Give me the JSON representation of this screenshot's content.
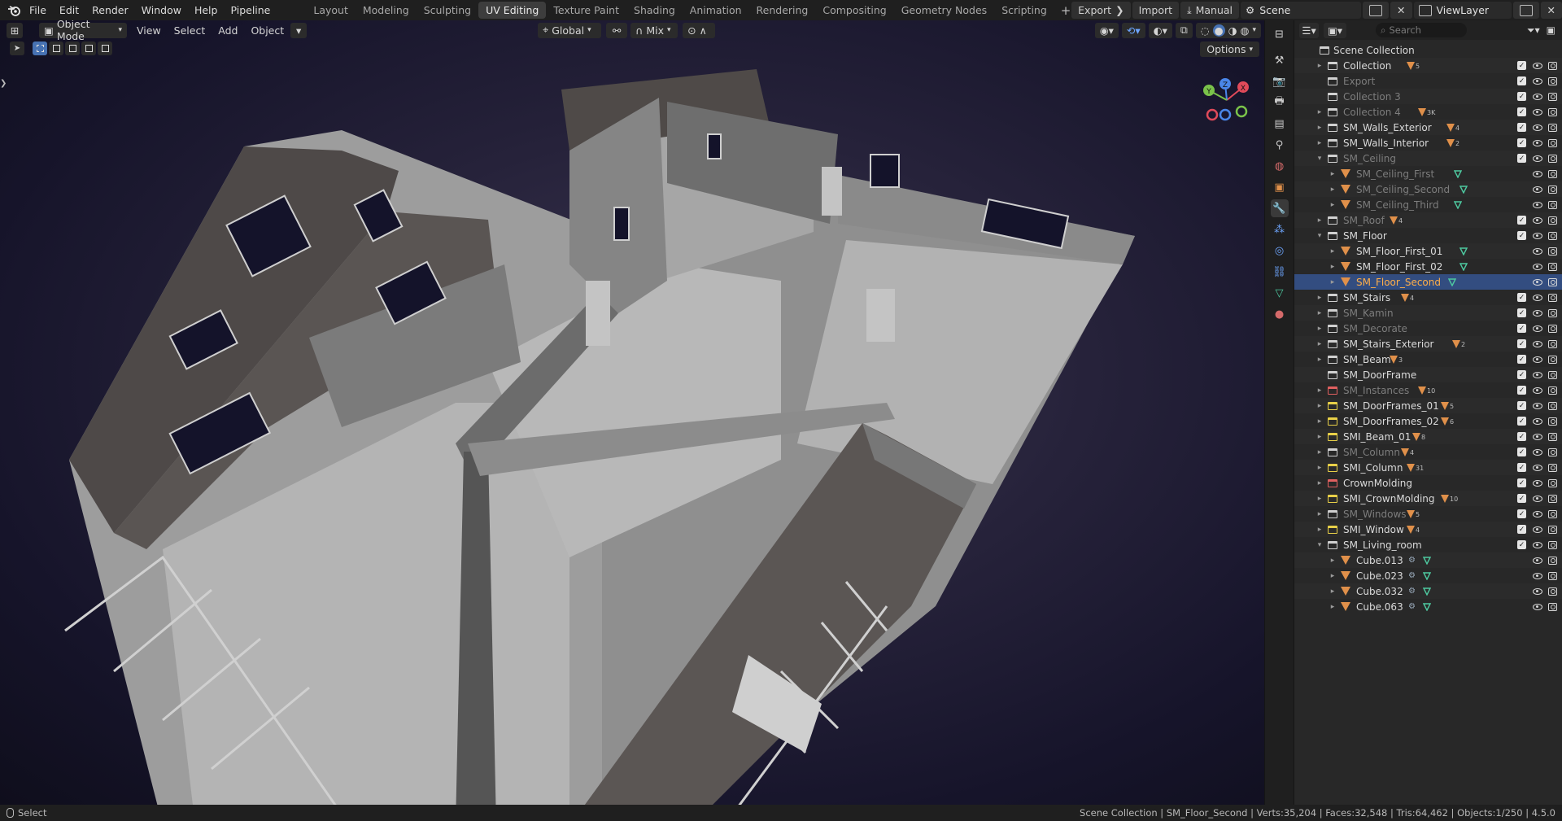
{
  "menu": {
    "items": [
      "File",
      "Edit",
      "Render",
      "Window",
      "Help",
      "Pipeline"
    ]
  },
  "workspaces": {
    "tabs": [
      {
        "label": "Layout",
        "active": false
      },
      {
        "label": "Modeling",
        "active": false
      },
      {
        "label": "Sculpting",
        "active": false
      },
      {
        "label": "UV Editing",
        "active": true
      },
      {
        "label": "Texture Paint",
        "active": false
      },
      {
        "label": "Shading",
        "active": false
      },
      {
        "label": "Animation",
        "active": false
      },
      {
        "label": "Rendering",
        "active": false
      },
      {
        "label": "Compositing",
        "active": false
      },
      {
        "label": "Geometry Nodes",
        "active": false
      },
      {
        "label": "Scripting",
        "active": false
      }
    ],
    "add_label": "+"
  },
  "topright": {
    "export_label": "Export",
    "import_label": "Import",
    "manual_label": "Manual",
    "scene_name": "Scene",
    "view_layer": "ViewLayer"
  },
  "viewport": {
    "mode": "Object Mode",
    "menus": [
      "View",
      "Select",
      "Add",
      "Object"
    ],
    "orientation": "Global",
    "snap_mode": "Mix",
    "options_label": "Options",
    "gizmo_axes": {
      "x": "X",
      "y": "Y",
      "z": "Z"
    }
  },
  "outliner": {
    "search_placeholder": "Search",
    "rows": [
      {
        "label": "Scene Collection",
        "depth": 0,
        "type": "scene",
        "arrow": "",
        "badge": "",
        "checks": false,
        "dim": false
      },
      {
        "label": "Collection",
        "depth": 1,
        "type": "coll",
        "arrow": "▸",
        "badge": "5",
        "checks": true,
        "dim": false
      },
      {
        "label": "Export",
        "depth": 1,
        "type": "coll",
        "arrow": "",
        "badge": "",
        "checks": true,
        "dim": true
      },
      {
        "label": "Collection 3",
        "depth": 1,
        "type": "coll",
        "arrow": "",
        "badge": "",
        "checks": true,
        "dim": true
      },
      {
        "label": "Collection 4",
        "depth": 1,
        "type": "coll",
        "arrow": "▸",
        "badge": "3K",
        "checks": true,
        "dim": true
      },
      {
        "label": "SM_Walls_Exterior",
        "depth": 1,
        "type": "coll",
        "arrow": "▸",
        "badge": "4",
        "checks": true,
        "dim": false
      },
      {
        "label": "SM_Walls_Interior",
        "depth": 1,
        "type": "coll",
        "arrow": "▸",
        "badge": "2",
        "checks": true,
        "dim": false
      },
      {
        "label": "SM_Ceiling",
        "depth": 1,
        "type": "coll",
        "arrow": "▾",
        "badge": "",
        "checks": true,
        "dim": true
      },
      {
        "label": "SM_Ceiling_First",
        "depth": 2,
        "type": "obj",
        "arrow": "▸",
        "badge": "",
        "green": true,
        "checks": false,
        "dim": true
      },
      {
        "label": "SM_Ceiling_Second",
        "depth": 2,
        "type": "obj",
        "arrow": "▸",
        "badge": "",
        "green": true,
        "checks": false,
        "dim": true
      },
      {
        "label": "SM_Ceiling_Third",
        "depth": 2,
        "type": "obj",
        "arrow": "▸",
        "badge": "",
        "green": true,
        "checks": false,
        "dim": true
      },
      {
        "label": "SM_Roof",
        "depth": 1,
        "type": "coll",
        "arrow": "▸",
        "badge": "4",
        "checks": true,
        "dim": true
      },
      {
        "label": "SM_Floor",
        "depth": 1,
        "type": "coll",
        "arrow": "▾",
        "badge": "",
        "checks": true,
        "dim": false
      },
      {
        "label": "SM_Floor_First_01",
        "depth": 2,
        "type": "obj",
        "arrow": "▸",
        "badge": "",
        "green": true,
        "checks": false,
        "dim": false,
        "hover": true
      },
      {
        "label": "SM_Floor_First_02",
        "depth": 2,
        "type": "obj",
        "arrow": "▸",
        "badge": "",
        "green": true,
        "checks": false,
        "dim": false
      },
      {
        "label": "SM_Floor_Second",
        "depth": 2,
        "type": "obj",
        "arrow": "▸",
        "badge": "",
        "green": true,
        "checks": false,
        "dim": false,
        "selected": true
      },
      {
        "label": "SM_Stairs",
        "depth": 1,
        "type": "coll",
        "arrow": "▸",
        "badge": "4",
        "checks": true,
        "dim": false
      },
      {
        "label": "SM_Kamin",
        "depth": 1,
        "type": "coll",
        "arrow": "▸",
        "badge": "",
        "checks": true,
        "dim": true
      },
      {
        "label": "SM_Decorate",
        "depth": 1,
        "type": "coll",
        "arrow": "▸",
        "badge": "",
        "checks": true,
        "dim": true
      },
      {
        "label": "SM_Stairs_Exterior",
        "depth": 1,
        "type": "coll",
        "arrow": "▸",
        "badge": "2",
        "checks": true,
        "dim": false
      },
      {
        "label": "SM_Beam",
        "depth": 1,
        "type": "coll",
        "arrow": "▸",
        "badge": "3",
        "checks": true,
        "dim": false
      },
      {
        "label": "SM_DoorFrame",
        "depth": 1,
        "type": "coll",
        "arrow": "",
        "badge": "",
        "checks": true,
        "dim": false
      },
      {
        "label": "SM_Instances",
        "depth": 1,
        "type": "coll-red",
        "arrow": "▸",
        "badge": "10",
        "checks": true,
        "dim": true
      },
      {
        "label": "SM_DoorFrames_01",
        "depth": 1,
        "type": "coll-yellow",
        "arrow": "▸",
        "badge": "5",
        "checks": true,
        "dim": false
      },
      {
        "label": "SM_DoorFrames_02",
        "depth": 1,
        "type": "coll-yellow",
        "arrow": "▸",
        "badge": "6",
        "checks": true,
        "dim": false
      },
      {
        "label": "SMI_Beam_01",
        "depth": 1,
        "type": "coll-yellow",
        "arrow": "▸",
        "badge": "8",
        "checks": true,
        "dim": false
      },
      {
        "label": "SM_Column",
        "depth": 1,
        "type": "coll",
        "arrow": "▸",
        "badge": "4",
        "checks": true,
        "dim": true
      },
      {
        "label": "SMI_Column",
        "depth": 1,
        "type": "coll-yellow",
        "arrow": "▸",
        "badge": "31",
        "checks": true,
        "dim": false
      },
      {
        "label": "CrownMolding",
        "depth": 1,
        "type": "coll-red",
        "arrow": "▸",
        "badge": "",
        "checks": true,
        "dim": false
      },
      {
        "label": "SMI_CrownMolding",
        "depth": 1,
        "type": "coll-yellow",
        "arrow": "▸",
        "badge": "10",
        "checks": true,
        "dim": false
      },
      {
        "label": "SM_Windows",
        "depth": 1,
        "type": "coll",
        "arrow": "▸",
        "badge": "5",
        "checks": true,
        "dim": true
      },
      {
        "label": "SMI_Window",
        "depth": 1,
        "type": "coll-yellow",
        "arrow": "▸",
        "badge": "4",
        "checks": true,
        "dim": false
      },
      {
        "label": "SM_Living_room",
        "depth": 1,
        "type": "coll",
        "arrow": "▾",
        "badge": "",
        "checks": true,
        "dim": false
      },
      {
        "label": "Cube.013",
        "depth": 2,
        "type": "obj",
        "arrow": "▸",
        "badge": "",
        "green": true,
        "mod": true,
        "checks": false,
        "dim": false
      },
      {
        "label": "Cube.023",
        "depth": 2,
        "type": "obj",
        "arrow": "▸",
        "badge": "",
        "green": true,
        "mod": true,
        "checks": false,
        "dim": false
      },
      {
        "label": "Cube.032",
        "depth": 2,
        "type": "obj",
        "arrow": "▸",
        "badge": "",
        "green": true,
        "mod": true,
        "checks": false,
        "dim": false
      },
      {
        "label": "Cube.063",
        "depth": 2,
        "type": "obj",
        "arrow": "▸",
        "badge": "",
        "green": true,
        "mod": true,
        "checks": false,
        "dim": false
      }
    ]
  },
  "status": {
    "left_label": "Select",
    "right_text": "Scene Collection | SM_Floor_Second | Verts:35,204 | Faces:32,548 | Tris:64,462 | Objects:1/250 | 4.5.0"
  },
  "colors": {
    "accent": "#4772b3",
    "selected_row": "#334d80",
    "object_orange": "#e0904a",
    "mesh_green": "#4ec9a0"
  }
}
